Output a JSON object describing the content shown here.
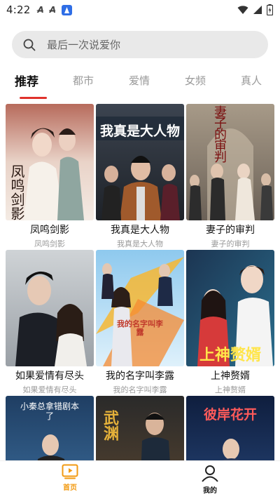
{
  "status_bar": {
    "time": "4:22",
    "left_icons": [
      "a-notification-icon",
      "a-notification-icon",
      "app-notification-icon"
    ],
    "right_icons": [
      "wifi-icon",
      "signal-icon",
      "battery-charging-icon"
    ]
  },
  "search": {
    "placeholder": "最后一次说爱你",
    "icon": "search-icon"
  },
  "tabs": [
    {
      "label": "推荐",
      "active": true
    },
    {
      "label": "都市",
      "active": false
    },
    {
      "label": "爱情",
      "active": false
    },
    {
      "label": "女频",
      "active": false
    },
    {
      "label": "真人",
      "active": false
    }
  ],
  "accent_color": "#e0322c",
  "dramas": [
    {
      "title": "凤鸣剑影",
      "subtitle": "凤鸣剑影",
      "poster_text": "凤鸣剑影"
    },
    {
      "title": "我真是大人物",
      "subtitle": "我真是大人物",
      "poster_text": "我真是大人物"
    },
    {
      "title": "妻子的审判",
      "subtitle": "妻子的审判",
      "poster_text": "妻子的审判"
    },
    {
      "title": "如果爱情有尽头",
      "subtitle": "如果爱情有尽头",
      "poster_text": ""
    },
    {
      "title": "我的名字叫李露",
      "subtitle": "我的名字叫李露",
      "poster_text": "我的名字叫李露"
    },
    {
      "title": "上神赘婿",
      "subtitle": "上神赘婿",
      "poster_text": "上神赘婿"
    },
    {
      "title": "",
      "subtitle": "",
      "poster_text": "小秦总拿错剧本了"
    },
    {
      "title": "",
      "subtitle": "",
      "poster_text": "武渊"
    },
    {
      "title": "",
      "subtitle": "",
      "poster_text": "彼岸花开"
    }
  ],
  "bottom_nav": [
    {
      "label": "首页",
      "icon": "play-tv-icon",
      "active": true,
      "color": "#f29a12"
    },
    {
      "label": "我的",
      "icon": "user-profile-icon",
      "active": false,
      "color": "#111111"
    }
  ]
}
